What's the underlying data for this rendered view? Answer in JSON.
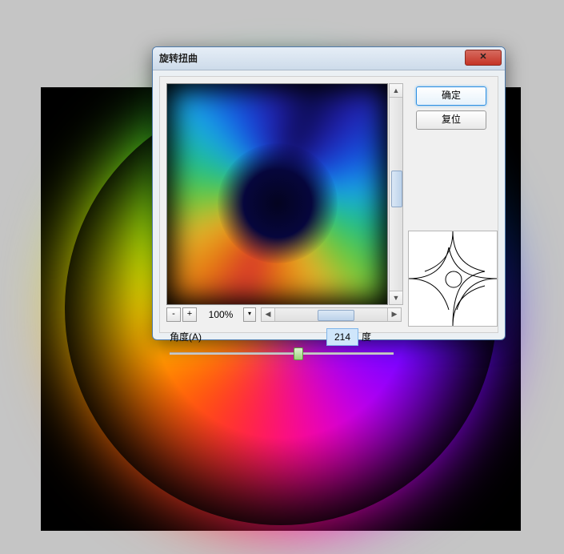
{
  "dialog": {
    "title": "旋转扭曲",
    "ok_label": "确定",
    "reset_label": "复位"
  },
  "zoom": {
    "minus": "-",
    "plus": "+",
    "value": "100%",
    "dropdown_glyph": "▾"
  },
  "angle": {
    "label": "角度(A)",
    "value": "214",
    "unit": "度"
  },
  "scroll": {
    "up": "▲",
    "down": "▼",
    "left": "◀",
    "right": "▶"
  },
  "close_glyph": "✕",
  "chart_data": {
    "type": "swirl",
    "angle_deg": 214,
    "zoom_pct": 100
  }
}
